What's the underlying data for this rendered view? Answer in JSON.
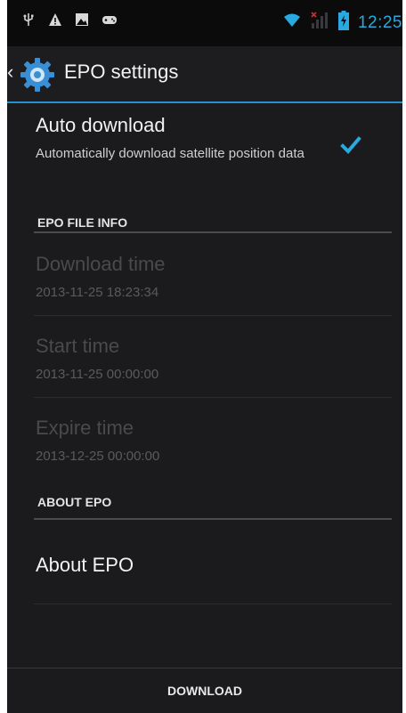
{
  "status_bar": {
    "time": "12:25",
    "icons": [
      "usb-icon",
      "warning-icon",
      "image-icon",
      "game-controller-icon",
      "wifi-icon",
      "signal-icon",
      "battery-icon"
    ],
    "accent_color": "#2aa8e0"
  },
  "action_bar": {
    "title": "EPO settings",
    "accent_color": "#2b8fc4"
  },
  "auto_download": {
    "title": "Auto download",
    "summary": "Automatically download satellite position data",
    "checked": true
  },
  "sections": {
    "file_info": "EPO FILE INFO",
    "about": "ABOUT EPO"
  },
  "file_info": {
    "download_time_label": "Download time",
    "download_time_value": "2013-11-25 18:23:34",
    "start_time_label": "Start time",
    "start_time_value": "2013-11-25 00:00:00",
    "expire_time_label": "Expire time",
    "expire_time_value": "2013-12-25 00:00:00"
  },
  "about": {
    "item_label": "About EPO"
  },
  "bottom": {
    "download_label": "DOWNLOAD"
  }
}
